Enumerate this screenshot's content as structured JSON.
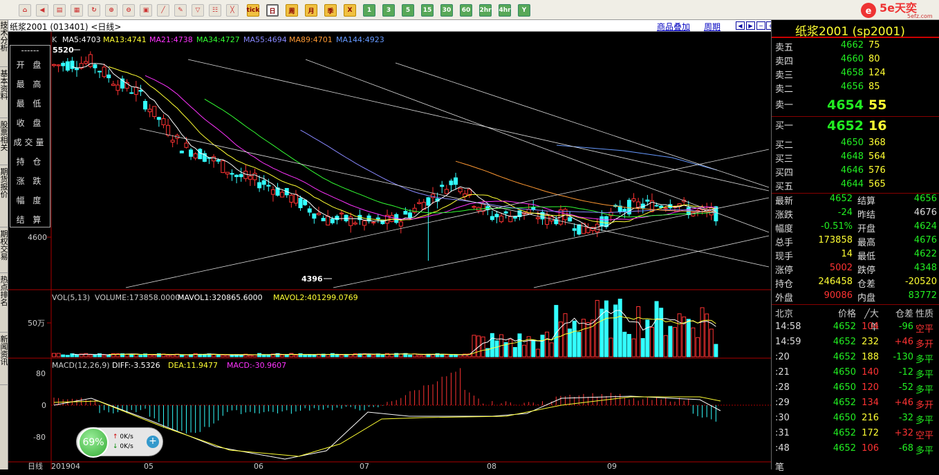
{
  "toolbar": {
    "buttons": [
      "home-icon",
      "back-icon",
      "list-icon",
      "news-icon",
      "refresh-icon",
      "zoom-in-icon",
      "zoom-out-icon",
      "window-icon",
      "draw-icon",
      "tool-icon",
      "filter-icon",
      "table-icon",
      "kline-icon",
      "tick",
      "日",
      "周",
      "月",
      "季",
      "X",
      "1",
      "3",
      "5",
      "15",
      "30",
      "60",
      "2hr",
      "4hr",
      "Y"
    ]
  },
  "brand": {
    "name": "5e天奕",
    "sub": "5efz.com"
  },
  "lefttabs": [
    "技术分析",
    "基本资料",
    "股票相关",
    "期货报价",
    "期权交易",
    "热点排名",
    "新闻资讯"
  ],
  "title": {
    "text": "纸浆2001 (013401) <日线>",
    "link1": "商品叠加",
    "link2": "周期"
  },
  "ma": {
    "k": "K",
    "ma5": "MA5:4703",
    "ma13": "MA13:4741",
    "ma21": "MA21:4738",
    "ma34": "MA34:4727",
    "ma55": "MA55:4694",
    "ma89": "MA89:4701",
    "ma144": "MA144:4923"
  },
  "price_labels": {
    "high": "5520",
    "low": "4396",
    "axis": "4600"
  },
  "infobox": [
    "开 盘",
    "最 高",
    "最 低",
    "收 盘",
    "成交量",
    "持 仓",
    "涨 跌",
    "幅 度",
    "结 算"
  ],
  "vol": {
    "label": "VOL(5,13)",
    "volume": "VOLUME:173858.0000",
    "mavol1": "MAVOL1:320865.6000",
    "mavol2": "MAVOL2:401299.0769",
    "axis": "50万"
  },
  "macd": {
    "label": "MACD(12,26,9)",
    "diff": "DIFF:-3.5326",
    "dea": "DEA:11.9477",
    "macd": "MACD:-30.9607",
    "ax1": "80",
    "ax0": "0",
    "ax2": "-80"
  },
  "xaxis": [
    "日线",
    "201904",
    "05",
    "06",
    "07",
    "08",
    "09"
  ],
  "quote": {
    "title": "纸浆2001 (sp2001)",
    "asks": [
      {
        "l": "卖五",
        "p": "4662",
        "v": "75"
      },
      {
        "l": "卖四",
        "p": "4660",
        "v": "80"
      },
      {
        "l": "卖三",
        "p": "4658",
        "v": "124"
      },
      {
        "l": "卖二",
        "p": "4656",
        "v": "85"
      },
      {
        "l": "卖一",
        "p": "4654",
        "v": "55"
      }
    ],
    "bids": [
      {
        "l": "买一",
        "p": "4652",
        "v": "16"
      },
      {
        "l": "买二",
        "p": "4650",
        "v": "368"
      },
      {
        "l": "买三",
        "p": "4648",
        "v": "564"
      },
      {
        "l": "买四",
        "p": "4646",
        "v": "576"
      },
      {
        "l": "买五",
        "p": "4644",
        "v": "565"
      }
    ],
    "stats": [
      {
        "k1": "最新",
        "v1": "4652",
        "k2": "结算",
        "v2": "4656"
      },
      {
        "k1": "涨跌",
        "v1": "-24",
        "k2": "昨结",
        "v2": "4676"
      },
      {
        "k1": "幅度",
        "v1": "-0.51%",
        "k2": "开盘",
        "v2": "4624"
      },
      {
        "k1": "总手",
        "v1": "173858",
        "k2": "最高",
        "v2": "4676"
      },
      {
        "k1": "现手",
        "v1": "14",
        "k2": "最低",
        "v2": "4622"
      },
      {
        "k1": "涨停",
        "v1": "5002",
        "k2": "跌停",
        "v2": "4348"
      },
      {
        "k1": "持仓",
        "v1": "246458",
        "k2": "仓差",
        "v2": "-20520"
      },
      {
        "k1": "外盘",
        "v1": "90086",
        "k2": "内盘",
        "v2": "83772"
      }
    ],
    "ticks_header": [
      "北京",
      "价格",
      "╱大单",
      "仓差",
      "性质"
    ],
    "ticks": [
      {
        "t": "14:58",
        "p": "4652",
        "v": "104",
        "d": "-96",
        "n": "空平"
      },
      {
        "t": "14:59",
        "p": "4652",
        "v": "232",
        "d": "+46",
        "n": "多开"
      },
      {
        "t": ":20",
        "p": "4652",
        "v": "188",
        "d": "-130",
        "n": "多平"
      },
      {
        "t": ":21",
        "p": "4650",
        "v": "140",
        "d": "-12",
        "n": "多平"
      },
      {
        "t": ":28",
        "p": "4650",
        "v": "120",
        "d": "-52",
        "n": "多平"
      },
      {
        "t": ":29",
        "p": "4652",
        "v": "134",
        "d": "+46",
        "n": "多开"
      },
      {
        "t": ":30",
        "p": "4650",
        "v": "216",
        "d": "-32",
        "n": "多平"
      },
      {
        "t": ":31",
        "p": "4652",
        "v": "172",
        "d": "+32",
        "n": "空平"
      },
      {
        "t": ":48",
        "p": "4652",
        "v": "106",
        "d": "-68",
        "n": "多平"
      }
    ],
    "footer": "笔"
  },
  "speed": {
    "pct": "69%",
    "up": "0K/s",
    "down": "0K/s"
  }
}
